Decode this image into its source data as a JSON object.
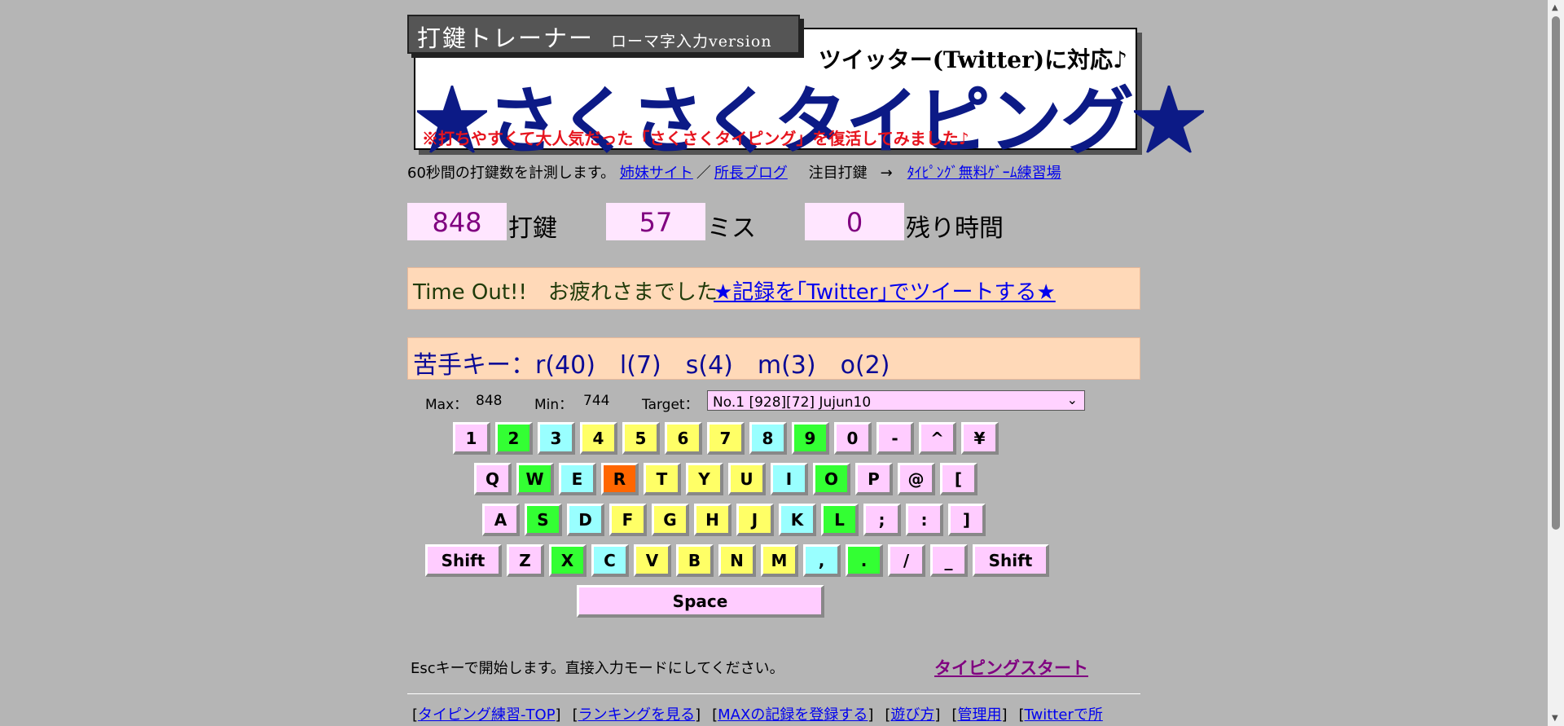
{
  "banner": {
    "tab_title": "打鍵トレーナー",
    "tab_subtitle": "ローマ字入力version",
    "twitter_note": "ツイッター(Twitter)に対応♪",
    "logo": "★さくさくタイピング★",
    "red_note": "※打ちやすくて大人気だった「さくさくタイピング」を復活してみました♪"
  },
  "intro": {
    "text": "60秒間の打鍵数を計測します。",
    "sister_link": "姉妹サイト",
    "separator": "／",
    "blog_link": "所長ブログ",
    "focus_label": "注目打鍵",
    "arrow": "→",
    "focus_link": "ﾀｲﾋﾟﾝｸﾞ無料ｹﾞｰﾑ練習場"
  },
  "counters": {
    "keystrokes": "848",
    "keystrokes_label": "打鍵",
    "misses": "57",
    "misses_label": "ミス",
    "remaining": "0",
    "remaining_label": "残り時間"
  },
  "timeout": {
    "message": "Time Out!!　お疲れさまでした",
    "tweet_link": "★記録を｢Twitter｣でツイートする★"
  },
  "weak_keys": {
    "text": "苦手キー：r(40)　l(7)　s(4)　m(3)　o(2)"
  },
  "stats": {
    "max_label": "Max：",
    "max_value": "848",
    "min_label": "Min：",
    "min_value": "744",
    "target_label": "Target：",
    "target_selected": "No.1 [928][72] Jujun10"
  },
  "keyboard": {
    "colors": {
      "pink": "#ffccff",
      "green": "#33ff33",
      "cyan": "#99ffff",
      "yellow": "#ffff66",
      "orange": "#ff6600"
    },
    "rows": [
      [
        {
          "label": "1",
          "color": "pink"
        },
        {
          "label": "2",
          "color": "green"
        },
        {
          "label": "3",
          "color": "cyan"
        },
        {
          "label": "4",
          "color": "yellow"
        },
        {
          "label": "5",
          "color": "yellow"
        },
        {
          "label": "6",
          "color": "yellow"
        },
        {
          "label": "7",
          "color": "yellow"
        },
        {
          "label": "8",
          "color": "cyan"
        },
        {
          "label": "9",
          "color": "green"
        },
        {
          "label": "0",
          "color": "pink"
        },
        {
          "label": "-",
          "color": "pink"
        },
        {
          "label": "^",
          "color": "pink"
        },
        {
          "label": "¥",
          "color": "pink"
        }
      ],
      [
        {
          "label": "Q",
          "color": "pink"
        },
        {
          "label": "W",
          "color": "green"
        },
        {
          "label": "E",
          "color": "cyan"
        },
        {
          "label": "R",
          "color": "orange"
        },
        {
          "label": "T",
          "color": "yellow"
        },
        {
          "label": "Y",
          "color": "yellow"
        },
        {
          "label": "U",
          "color": "yellow"
        },
        {
          "label": "I",
          "color": "cyan"
        },
        {
          "label": "O",
          "color": "green"
        },
        {
          "label": "P",
          "color": "pink"
        },
        {
          "label": "@",
          "color": "pink"
        },
        {
          "label": "[",
          "color": "pink"
        }
      ],
      [
        {
          "label": "A",
          "color": "pink"
        },
        {
          "label": "S",
          "color": "green"
        },
        {
          "label": "D",
          "color": "cyan"
        },
        {
          "label": "F",
          "color": "yellow"
        },
        {
          "label": "G",
          "color": "yellow"
        },
        {
          "label": "H",
          "color": "yellow"
        },
        {
          "label": "J",
          "color": "yellow"
        },
        {
          "label": "K",
          "color": "cyan"
        },
        {
          "label": "L",
          "color": "green"
        },
        {
          "label": ";",
          "color": "pink"
        },
        {
          "label": ":",
          "color": "pink"
        },
        {
          "label": "]",
          "color": "pink"
        }
      ],
      [
        {
          "label": "Shift",
          "color": "pink"
        },
        {
          "label": "Z",
          "color": "pink"
        },
        {
          "label": "X",
          "color": "green"
        },
        {
          "label": "C",
          "color": "cyan"
        },
        {
          "label": "V",
          "color": "yellow"
        },
        {
          "label": "B",
          "color": "yellow"
        },
        {
          "label": "N",
          "color": "yellow"
        },
        {
          "label": "M",
          "color": "yellow"
        },
        {
          "label": ",",
          "color": "cyan"
        },
        {
          "label": ".",
          "color": "green"
        },
        {
          "label": "/",
          "color": "pink"
        },
        {
          "label": "_",
          "color": "pink"
        },
        {
          "label": "Shift",
          "color": "pink"
        }
      ],
      [
        {
          "label": "Space",
          "color": "pink"
        }
      ]
    ]
  },
  "footer": {
    "help_text": "Escキーで開始します。直接入力モードにしてください。",
    "start_link": "タイピングスタート",
    "links": [
      "タイピング練習-TOP",
      "ランキングを見る",
      "MAXの記録を登録する",
      "遊び方",
      "管理用",
      "Twitterで所"
    ]
  }
}
